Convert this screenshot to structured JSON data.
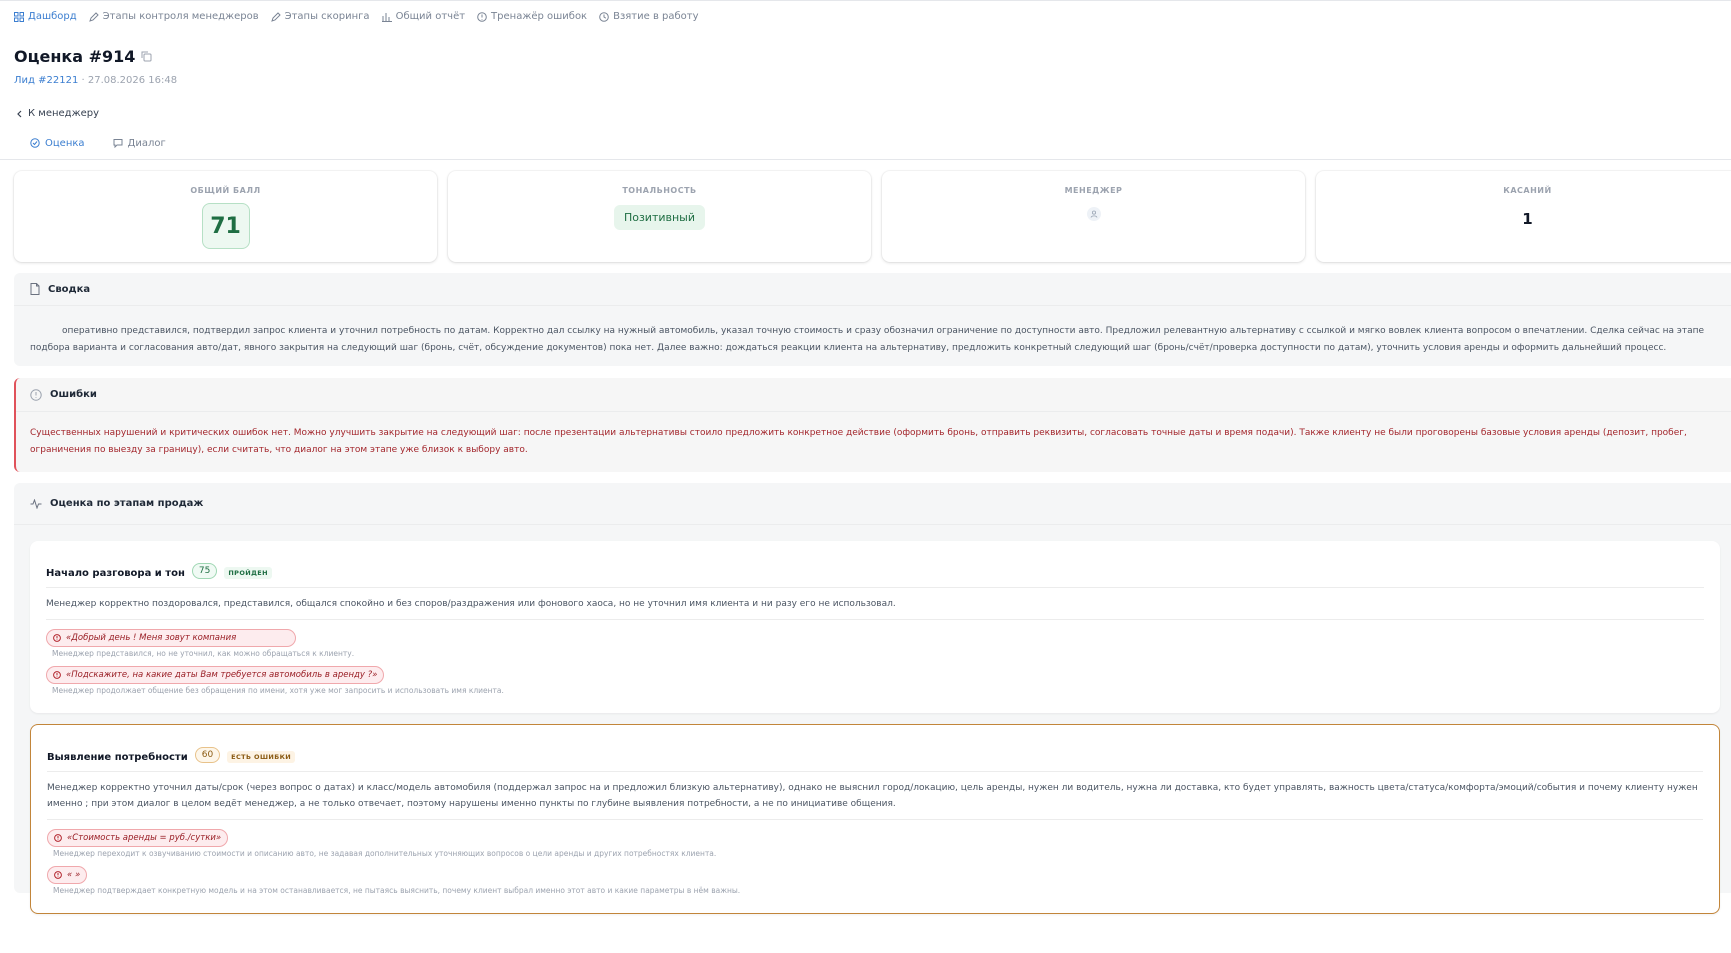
{
  "nav": {
    "items": [
      {
        "label": "Дашборд",
        "icon": "grid-icon"
      },
      {
        "label": "Этапы контроля менеджеров",
        "icon": "pencil-icon"
      },
      {
        "label": "Этапы скоринга",
        "icon": "pencil-icon"
      },
      {
        "label": "Общий отчёт",
        "icon": "bar-chart-icon"
      },
      {
        "label": "Тренажёр ошибок",
        "icon": "alert-circle-icon"
      },
      {
        "label": "Взятие в работу",
        "icon": "clock-icon"
      }
    ]
  },
  "header": {
    "title": "Оценка #914",
    "lead_link": "Лид #22121",
    "date": " · 27.08.2026 16:48"
  },
  "back_link": "К менеджеру",
  "tabs": [
    {
      "label": "Оценка",
      "active": true
    },
    {
      "label": "Диалог",
      "active": false
    }
  ],
  "metrics": {
    "total": {
      "label": "ОБЩИЙ БАЛЛ",
      "value": "71"
    },
    "tone": {
      "label": "ТОНАЛЬНОСТЬ",
      "value": "Позитивный"
    },
    "manager": {
      "label": "МЕНЕДЖЕР"
    },
    "touches": {
      "label": "КАСАНИЙ",
      "value": "1"
    }
  },
  "summary": {
    "title": "Сводка",
    "text": "оперативно представился, подтвердил запрос клиента и уточнил потребность по датам. Корректно дал ссылку на нужный автомобиль, указал точную стоимость и сразу обозначил ограничение по доступности авто. Предложил релевантную альтернативу с ссылкой и мягко вовлек клиента вопросом о впечатлении. Сделка сейчас на этапе подбора варианта и согласования авто/дат, явного закрытия на следующий шаг (бронь, счёт, обсуждение документов) пока нет. Далее важно: дождаться реакции клиента на альтернативу, предложить конкретный следующий шаг (бронь/счёт/проверка доступности по датам), уточнить условия аренды и оформить дальнейший процесс."
  },
  "errors": {
    "title": "Ошибки",
    "text": "Существенных нарушений и критических ошибок нет. Можно улучшить закрытие на следующий шаг: после презентации альтернативы стоило предложить конкретное действие (оформить бронь, отправить реквизиты, согласовать точные даты и время подачи). Также клиенту не были проговорены базовые условия аренды (депозит, пробег, ограничения по выезду за границу), если считать, что диалог на этом этапе уже близок к выбору авто."
  },
  "stages": {
    "title": "Оценка по этапам продаж",
    "items": [
      {
        "title": "Начало разговора и тон",
        "score": "75",
        "badge": "ПРОЙДЕН",
        "description": "Менеджер корректно поздоровался, представился, общался спокойно и без споров/раздражения или фонового хаоса, но не уточнил имя клиента и ни разу его не использовал.",
        "quotes": [
          {
            "quote": "«Добрый день ! Меня зовут компания",
            "note": "Менеджер представился, но не уточнил, как можно обращаться к клиенту."
          },
          {
            "quote": "«Подскажите, на какие даты Вам требуется автомобиль в аренду ?»",
            "note": "Менеджер продолжает общение без обращения по имени, хотя уже мог запросить и использовать имя клиента."
          }
        ]
      },
      {
        "title": "Выявление потребности",
        "score": "60",
        "badge": "ЕСТЬ ОШИБКИ",
        "description": "Менеджер корректно уточнил даты/срок (через вопрос о датах) и класс/модель автомобиля (поддержал запрос на и предложил близкую альтернативу), однако не выяснил город/локацию, цель аренды, нужен ли водитель, нужна ли доставка, кто будет управлять, важность цвета/статуса/комфорта/эмоций/события и почему клиенту нужен именно ; при этом диалог в целом ведёт менеджер, а не только отвечает, поэтому нарушены именно пункты по глубине выявления потребности, а не по инициативе общения.",
        "quotes": [
          {
            "quote": "«Стоимость аренды = руб./сутки»",
            "note": "Менеджер переходит к озвучиванию стоимости и описанию авто, не задавая дополнительных уточняющих вопросов о цели аренды и других потребностях клиента."
          },
          {
            "quote": "«                                   »",
            "note": "Менеджер подтверждает конкретную модель и на этом останавливается, не пытаясь выяснить, почему клиент выбрал именно этот авто и какие параметры в нём важны."
          }
        ]
      }
    ]
  },
  "colors": {
    "accent": "#3b7ed0",
    "success": "#1f6e43",
    "danger": "#a3262c",
    "warning": "#c2853a"
  }
}
